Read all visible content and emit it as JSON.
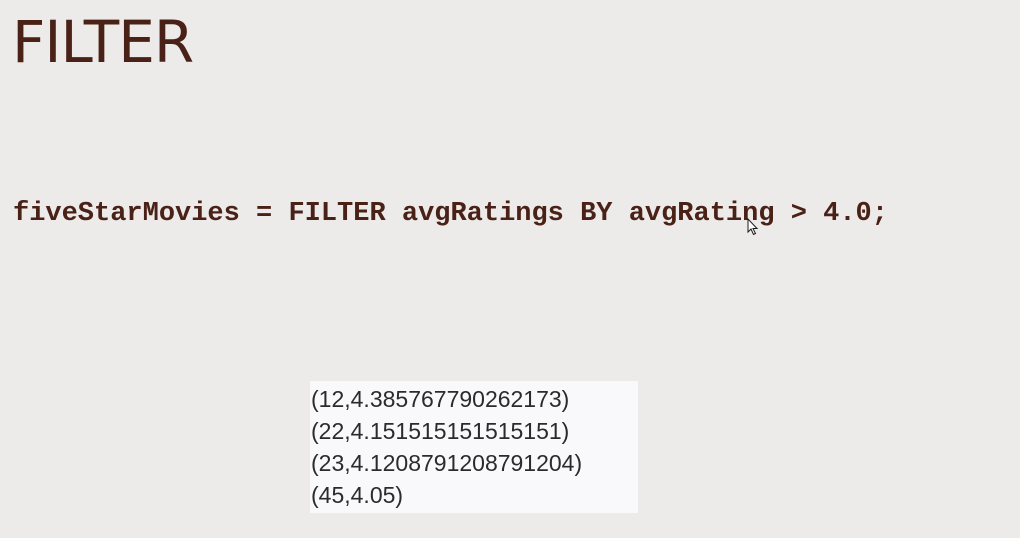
{
  "slide": {
    "title": "FILTER",
    "code": "fiveStarMovies = FILTER avgRatings BY avgRating > 4.0;"
  },
  "results": {
    "rows": [
      "(12,4.385767790262173)",
      "(22,4.151515151515151)",
      "(23,4.1208791208791204)",
      "(45,4.05)"
    ]
  },
  "colors": {
    "background": "#edebe9",
    "title_text": "#4a2117",
    "result_box": "#f9f9fb",
    "result_text": "#2b2b2b"
  },
  "icons": {
    "cursor": "mouse-pointer-icon"
  }
}
